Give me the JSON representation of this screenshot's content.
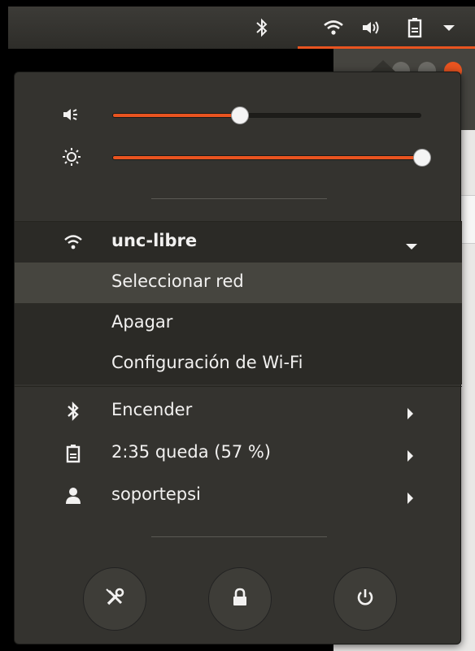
{
  "panel": {
    "icons": [
      "bluetooth-icon",
      "wifi-icon",
      "volume-icon",
      "battery-icon",
      "menu-arrow-icon"
    ],
    "accent": "#e95420"
  },
  "sliders": {
    "volume": {
      "icon": "volume-icon",
      "level": 0.41
    },
    "brightness": {
      "icon": "brightness-icon",
      "level": 1.0
    }
  },
  "wifi": {
    "network_name": "unc-libre",
    "submenu": [
      "Seleccionar red",
      "Apagar",
      "Configuración de Wi-Fi"
    ]
  },
  "items": {
    "bluetooth": "Encender",
    "battery": "2:35 queda (57 %)",
    "user": "soportepsi"
  },
  "actions": [
    "settings-icon",
    "lock-icon",
    "power-icon"
  ]
}
